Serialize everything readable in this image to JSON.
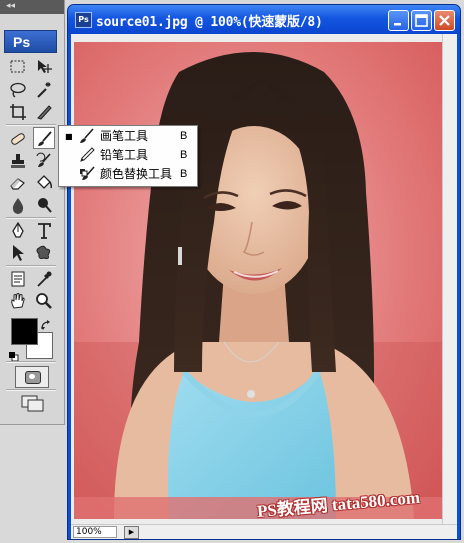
{
  "app": {
    "logo": "Ps"
  },
  "toolbox": {
    "grip_label": "◂◂",
    "tools": [
      "rect-marquee",
      "move",
      "lasso",
      "magic-wand",
      "crop",
      "slice",
      "healing",
      "brush",
      "clone-stamp",
      "history-brush",
      "eraser",
      "paint-bucket",
      "blur",
      "dodge",
      "pen",
      "type",
      "path-select",
      "custom-shape",
      "notes",
      "eyedropper",
      "hand",
      "zoom"
    ],
    "active_tool": "brush",
    "foreground_color": "#000000",
    "background_color": "#ffffff"
  },
  "document": {
    "title": "source01.jpg @ 100%(快速蒙版/8)",
    "zoom": "100%",
    "mask_color": "#e07070"
  },
  "flyout_menu": {
    "items": [
      {
        "label": "画笔工具",
        "shortcut": "B",
        "selected": true
      },
      {
        "label": "铅笔工具",
        "shortcut": "B",
        "selected": false
      },
      {
        "label": "颜色替换工具",
        "shortcut": "B",
        "selected": false
      }
    ],
    "bullet": "■"
  },
  "watermark": "PS教程网 tata580.com"
}
